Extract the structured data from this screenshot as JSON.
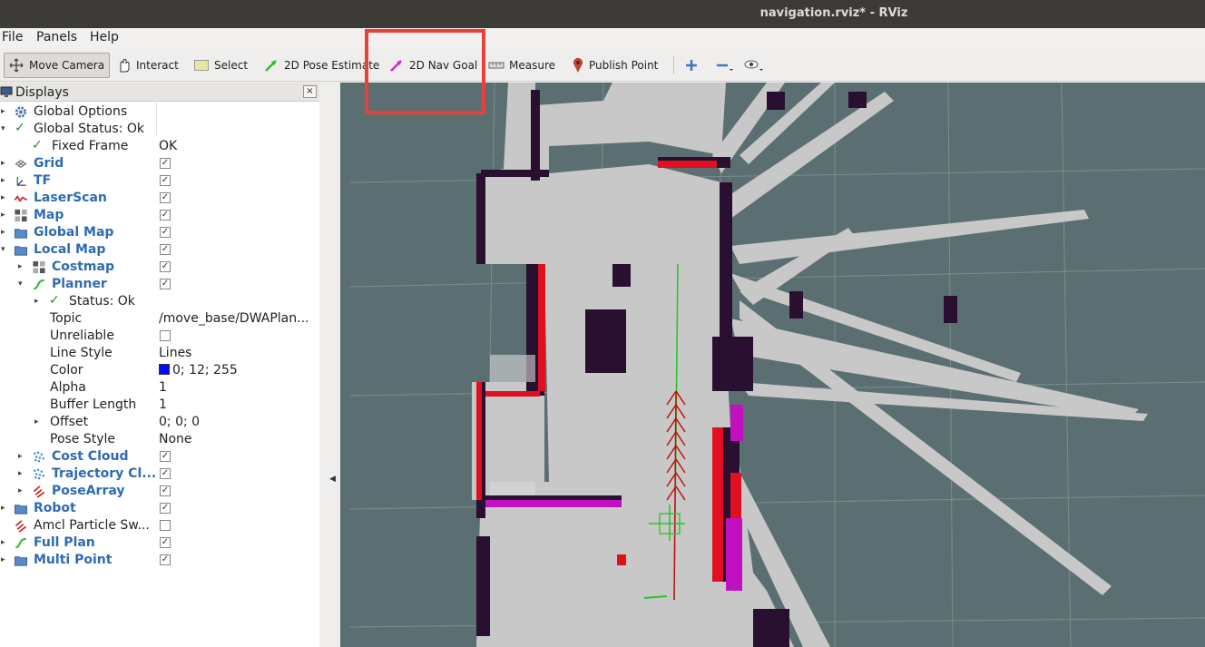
{
  "window": {
    "title": "navigation.rviz* - RViz"
  },
  "menu": {
    "file": "File",
    "panels": "Panels",
    "help": "Help"
  },
  "toolbar": {
    "move_camera": "Move Camera",
    "interact": "Interact",
    "select": "Select",
    "pose_estimate": "2D Pose Estimate",
    "nav_goal": "2D Nav Goal",
    "measure": "Measure",
    "publish_point": "Publish Point"
  },
  "displays": {
    "title": "Displays",
    "close": "×",
    "rows": [
      {
        "label": "Global Options",
        "value": ""
      },
      {
        "label": "Global Status: Ok",
        "value": ""
      },
      {
        "label": "Fixed Frame",
        "value": "OK"
      },
      {
        "label": "Grid",
        "checked": true
      },
      {
        "label": "TF",
        "checked": true
      },
      {
        "label": "LaserScan",
        "checked": true
      },
      {
        "label": "Map",
        "checked": true
      },
      {
        "label": "Global Map",
        "checked": true
      },
      {
        "label": "Local Map",
        "checked": true
      },
      {
        "label": "Costmap",
        "checked": true
      },
      {
        "label": "Planner",
        "checked": true
      },
      {
        "label": "Status: Ok",
        "value": ""
      },
      {
        "label": "Topic",
        "value": "/move_base/DWAPlan..."
      },
      {
        "label": "Unreliable",
        "checked": false
      },
      {
        "label": "Line Style",
        "value": "Lines"
      },
      {
        "label": "Color",
        "value": "0; 12; 255"
      },
      {
        "label": "Alpha",
        "value": "1"
      },
      {
        "label": "Buffer Length",
        "value": "1"
      },
      {
        "label": "Offset",
        "value": "0; 0; 0"
      },
      {
        "label": "Pose Style",
        "value": "None"
      },
      {
        "label": "Cost Cloud",
        "checked": true
      },
      {
        "label": "Trajectory Cl...",
        "checked": true
      },
      {
        "label": "PoseArray",
        "checked": true
      },
      {
        "label": "Robot",
        "checked": true
      },
      {
        "label": "Amcl Particle Sw...",
        "checked": false
      },
      {
        "label": "Full Plan",
        "checked": true
      },
      {
        "label": "Multi Point",
        "checked": true
      }
    ]
  },
  "colors": {
    "planner_color": "#000cff",
    "highlight": "#e8403a",
    "map_free": "#c8c8c8",
    "map_unknown": "#5b6f72"
  }
}
